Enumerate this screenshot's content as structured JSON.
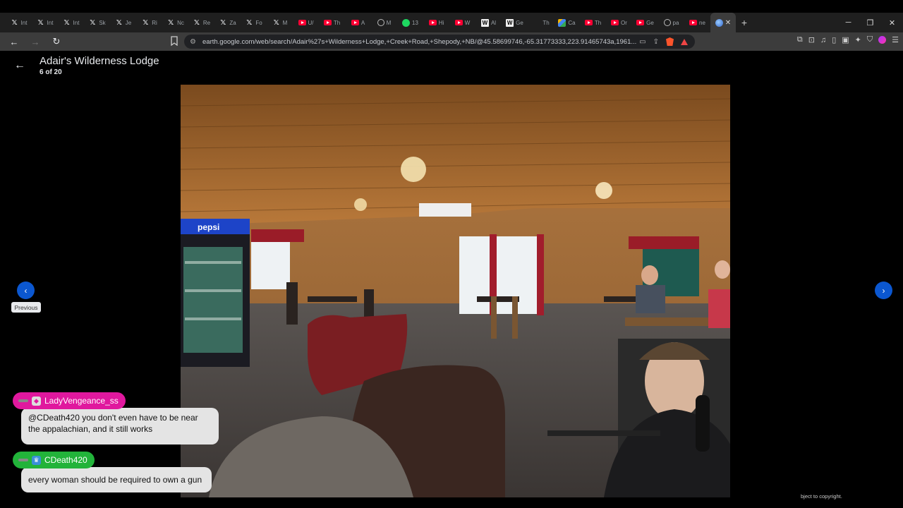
{
  "browser": {
    "tabs": [
      {
        "icon": "x-icon",
        "label": "Int"
      },
      {
        "icon": "x-icon",
        "label": "Int"
      },
      {
        "icon": "x-icon",
        "label": "Int"
      },
      {
        "icon": "x-icon",
        "label": "Sk"
      },
      {
        "icon": "x-icon",
        "label": "Je"
      },
      {
        "icon": "x-icon",
        "label": "Ri"
      },
      {
        "icon": "x-icon",
        "label": "Nc"
      },
      {
        "icon": "x-icon",
        "label": "Re"
      },
      {
        "icon": "x-icon",
        "label": "Za"
      },
      {
        "icon": "x-icon",
        "label": "Fo"
      },
      {
        "icon": "x-icon",
        "label": "M"
      },
      {
        "icon": "youtube-icon",
        "label": "U/"
      },
      {
        "icon": "youtube-icon",
        "label": "Th"
      },
      {
        "icon": "youtube-icon",
        "label": "A"
      },
      {
        "icon": "circle-icon",
        "label": "M"
      },
      {
        "icon": "spotify-icon",
        "label": "13"
      },
      {
        "icon": "youtube-icon",
        "label": "Hi"
      },
      {
        "icon": "youtube-icon",
        "label": "W"
      },
      {
        "icon": "wikipedia-icon",
        "label": "Al"
      },
      {
        "icon": "wikipedia-icon",
        "label": "Ge"
      },
      {
        "icon": "blank-icon",
        "label": "Th"
      },
      {
        "icon": "maps-icon",
        "label": "Ca"
      },
      {
        "icon": "youtube-icon",
        "label": "Th"
      },
      {
        "icon": "youtube-icon",
        "label": "Or"
      },
      {
        "icon": "youtube-icon",
        "label": "Ge"
      },
      {
        "icon": "circle-icon",
        "label": "pa"
      },
      {
        "icon": "youtube-icon",
        "label": "ne"
      }
    ],
    "url": "earth.google.com/web/search/Adair%27s+Wilderness+Lodge,+Creek+Road,+Shepody,+NB/@45.58699746,-65.31773333,223.91465743a,1961..."
  },
  "viewer": {
    "back_icon": "arrow-left-icon",
    "title": "Adair's Wilderness Lodge",
    "counter": "6 of 20",
    "prev_icon": "chevron-left-icon",
    "next_icon": "chevron-right-icon",
    "prev_tooltip": "Previous",
    "copyright": "bject to copyright."
  },
  "chat": [
    {
      "user": "LadyVengeance_ss",
      "color": "#e0189e",
      "message": "@CDeath420 you don't even have to be near the appalachian, and it still works"
    },
    {
      "user": "CDeath420",
      "color": "#22b33a",
      "message": "every woman should be required to own a gun"
    }
  ],
  "colors": {
    "accent": "#0b57d0",
    "tab_bg": "#1f1f1f",
    "toolbar_bg": "#3c3c3c"
  }
}
